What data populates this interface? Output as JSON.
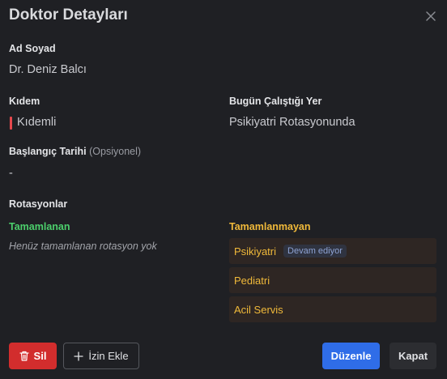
{
  "dialog": {
    "title": "Doktor Detayları"
  },
  "fields": {
    "name_label": "Ad Soyad",
    "name_value": "Dr. Deniz Balcı",
    "seniority_label": "Kıdem",
    "seniority_value": "Kıdemli",
    "today_location_label": "Bugün Çalıştığı Yer",
    "today_location_value": "Psikiyatri Rotasyonunda",
    "start_date_label": "Başlangıç Tarihi",
    "start_date_optional": "(Opsiyonel)",
    "start_date_value": "-"
  },
  "rotations": {
    "section_label": "Rotasyonlar",
    "completed_label": "Tamamlanan",
    "completed_empty": "Henüz tamamlanan rotasyon yok",
    "incomplete_label": "Tamamlanmayan",
    "incomplete_items": [
      {
        "name": "Psikiyatri",
        "badge": "Devam ediyor"
      },
      {
        "name": "Pediatri"
      },
      {
        "name": "Acil Servis"
      }
    ]
  },
  "actions": {
    "delete": "Sil",
    "add_leave": "İzin Ekle",
    "edit": "Düzenle",
    "close": "Kapat"
  },
  "colors": {
    "background": "#1f2024",
    "seniority_indicator": "#e5484d",
    "completed": "#4ccf6c",
    "incomplete": "#f0b93a",
    "delete": "#d22d2d",
    "primary": "#2f6de8"
  },
  "icons": {
    "close": "close-icon",
    "delete": "trash-icon",
    "add": "plus-icon"
  }
}
